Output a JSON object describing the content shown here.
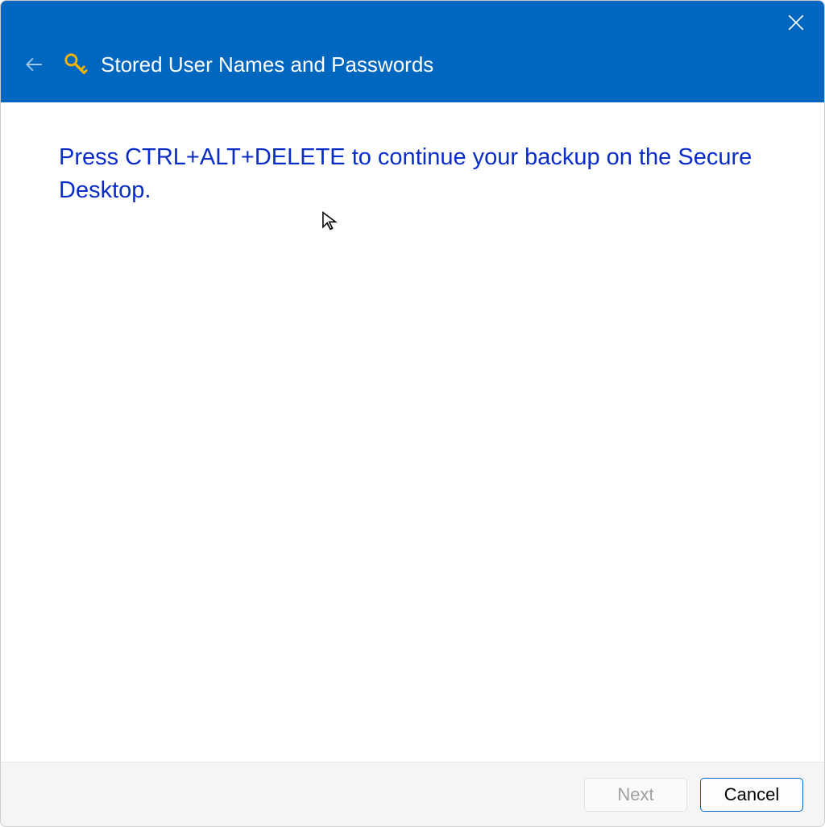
{
  "header": {
    "title": "Stored User Names and Passwords"
  },
  "content": {
    "instruction": "Press CTRL+ALT+DELETE to continue your backup on the Secure Desktop."
  },
  "footer": {
    "next_label": "Next",
    "cancel_label": "Cancel"
  }
}
